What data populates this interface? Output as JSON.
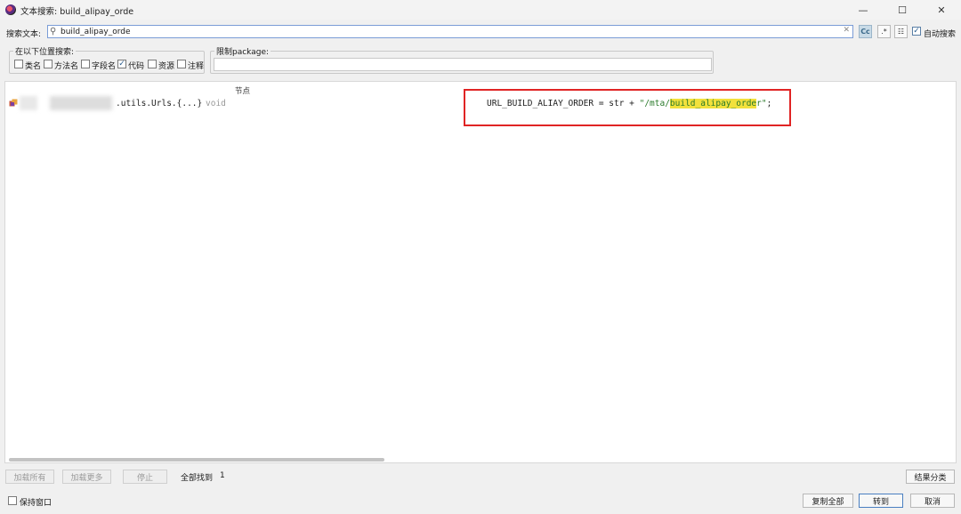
{
  "window": {
    "title": "文本搜索: build_alipay_orde",
    "minimize_glyph": "—",
    "maximize_glyph": "☐",
    "close_glyph": "✕"
  },
  "search": {
    "label": "搜索文本:",
    "value": "build_alipay_orde",
    "clear_glyph": "✕",
    "case_label": "Cc",
    "regex_label": ".*",
    "word_label": "☷",
    "auto_search": {
      "label": "自动搜索",
      "checked": true
    }
  },
  "search_in": {
    "title": "在以下位置搜索:",
    "options": [
      {
        "label": "类名",
        "checked": false
      },
      {
        "label": "方法名",
        "checked": false
      },
      {
        "label": "字段名",
        "checked": false
      },
      {
        "label": "代码",
        "checked": true
      },
      {
        "label": "资源",
        "checked": false
      },
      {
        "label": "注释",
        "checked": false
      }
    ]
  },
  "package_filter": {
    "title": "限制package:",
    "value": ""
  },
  "results": {
    "column_header": "节点",
    "rows": [
      {
        "node": ".utils.Urls.{...}",
        "type": "void",
        "code_prefix": "URL_BUILD_ALIAY_ORDER = str + ",
        "code_string_open": "\"/mta/",
        "code_match": "build_alipay_orde",
        "code_string_close": "r\"",
        "code_suffix": ";"
      }
    ]
  },
  "footer": {
    "load_all": "加载所有",
    "load_more": "加载更多",
    "stop": "停止",
    "found_label": "全部找到",
    "found_count": "1",
    "group_results": "结果分类",
    "keep_window": {
      "label": "保持窗口",
      "checked": false
    },
    "copy_all": "复制全部",
    "goto": "转到",
    "cancel": "取消"
  },
  "colors": {
    "highlight": "#f2e13c",
    "annotation_box": "#e02424",
    "string_literal": "#2a7a2a"
  }
}
